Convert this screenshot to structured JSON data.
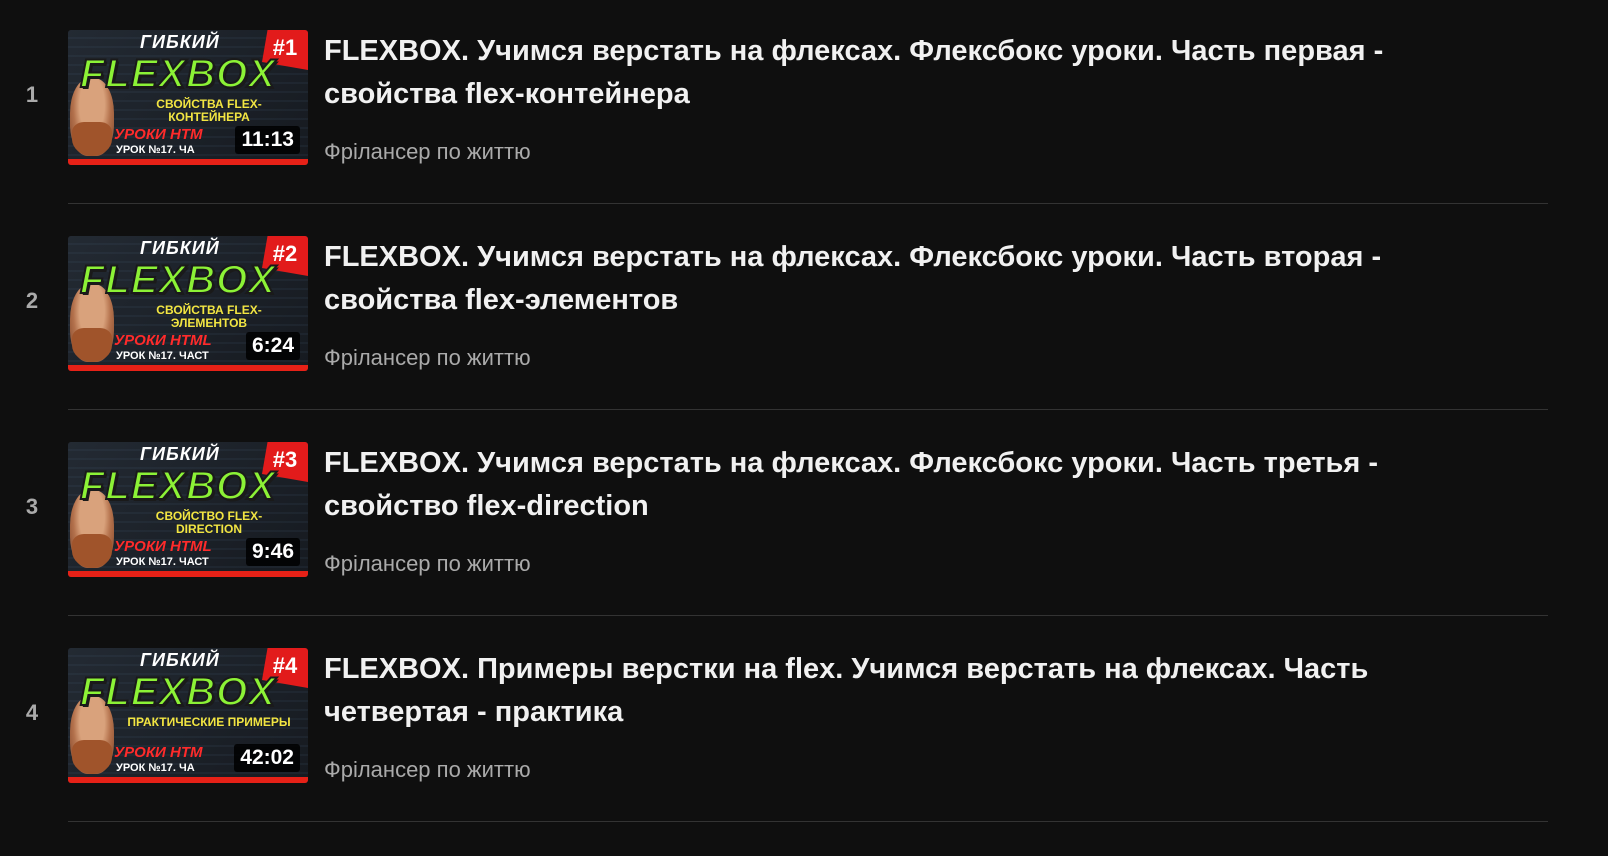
{
  "playlist": {
    "items": [
      {
        "index": "1",
        "title": "FLEXBOX. Учимся верстать на флексах. Флексбокс уроки. Часть первая - свойства flex-контейнера",
        "channel": "Фрілансер по життю",
        "duration": "11:13",
        "thumb": {
          "top": "ГИБКИЙ",
          "badge": "#1",
          "main": "FLEXBOX",
          "sub": "СВОЙСТВА FLEX-КОНТЕЙНЕРА",
          "lesson": "УРОКИ HTM",
          "part": "УРОК №17. ЧА"
        }
      },
      {
        "index": "2",
        "title": "FLEXBOX. Учимся верстать на флексах. Флексбокс уроки. Часть вторая - свойства flex-элементов",
        "channel": "Фрілансер по життю",
        "duration": "6:24",
        "thumb": {
          "top": "ГИБКИЙ",
          "badge": "#2",
          "main": "FLEXBOX",
          "sub": "СВОЙСТВА FLEX-ЭЛЕМЕНТОВ",
          "lesson": "УРОКИ HTML",
          "part": "УРОК №17. ЧАСТ"
        }
      },
      {
        "index": "3",
        "title": "FLEXBOX. Учимся верстать на флексах. Флексбокс уроки. Часть третья - свойство flex-direction",
        "channel": "Фрілансер по життю",
        "duration": "9:46",
        "thumb": {
          "top": "ГИБКИЙ",
          "badge": "#3",
          "main": "FLEXBOX",
          "sub": "СВОЙСТВО FLEX-DIRECTION",
          "lesson": "УРОКИ HTML",
          "part": "УРОК №17. ЧАСТ"
        }
      },
      {
        "index": "4",
        "title": "FLEXBOX. Примеры верстки на flex. Учимся верстать на флексах. Часть четвертая - практика",
        "channel": "Фрілансер по життю",
        "duration": "42:02",
        "thumb": {
          "top": "ГИБКИЙ",
          "badge": "#4",
          "main": "FLEXBOX",
          "sub": "ПРАКТИЧЕСКИЕ ПРИМЕРЫ",
          "lesson": "УРОКИ HTM",
          "part": "УРОК №17. ЧА"
        }
      }
    ]
  },
  "colors": {
    "background": "#0f0f0f",
    "title": "#f1f1f1",
    "secondary_text": "#aaaaaa",
    "progress_bar": "#e62117",
    "thumb_green": "#8cf236",
    "thumb_red": "#e21b1b"
  }
}
